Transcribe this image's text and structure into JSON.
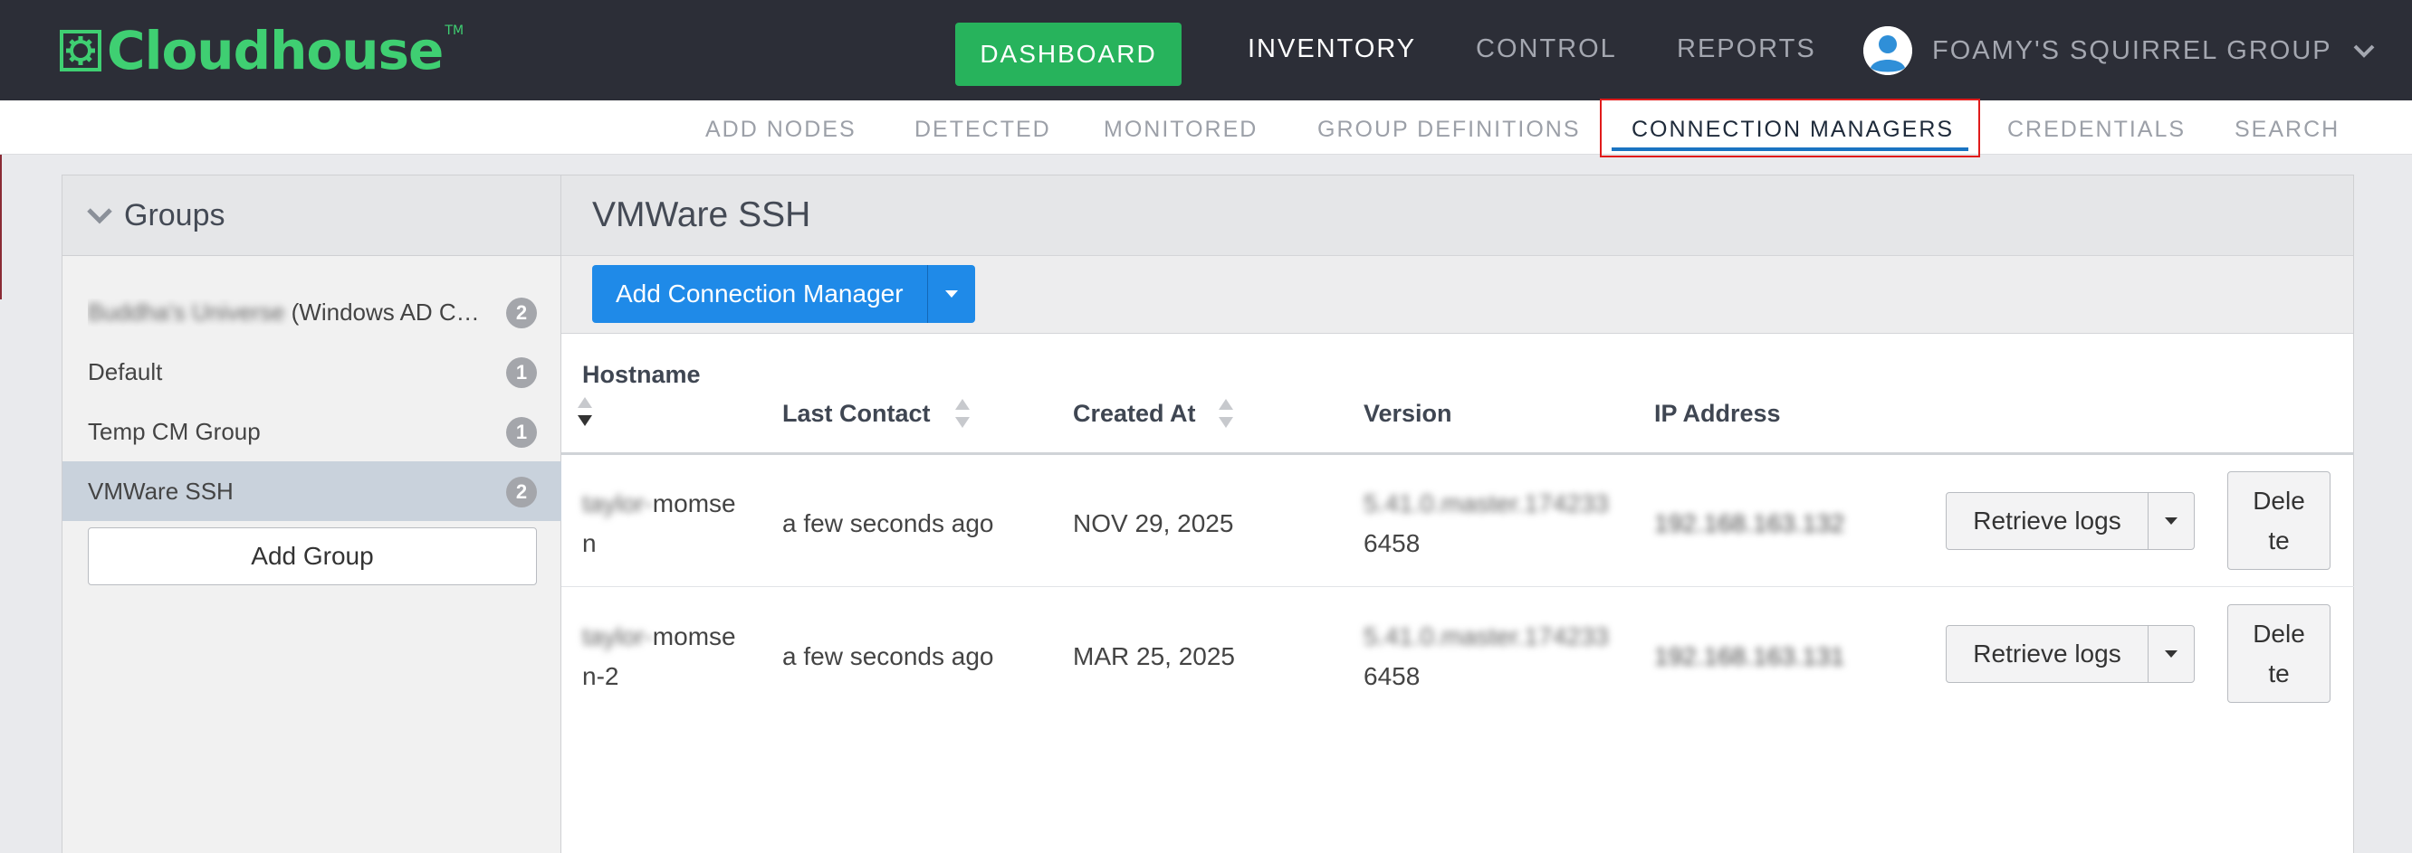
{
  "brand": {
    "name": "Cloudhouse",
    "tm": "TM",
    "color": "#3fcf72"
  },
  "topnav": {
    "dashboard": "DASHBOARD",
    "inventory": "INVENTORY",
    "control": "CONTROL",
    "reports": "REPORTS",
    "user": "FOAMY'S SQUIRREL GROUP"
  },
  "subnav": [
    "ADD NODES",
    "DETECTED",
    "MONITORED",
    "GROUP DEFINITIONS",
    "CONNECTION MANAGERS",
    "CREDENTIALS",
    "SEARCH"
  ],
  "groups": {
    "title": "Groups",
    "items": [
      {
        "blurred": "Buddha's Universe",
        "name": " (Windows AD C…",
        "count": "2"
      },
      {
        "name": "Default",
        "count": "1"
      },
      {
        "name": "Temp CM Group",
        "count": "1"
      },
      {
        "name": "VMWare SSH",
        "count": "2"
      }
    ],
    "add_label": "Add Group"
  },
  "main": {
    "title": "VMWare SSH",
    "add_button": "Add Connection Manager",
    "columns": [
      "Hostname",
      "Last Contact",
      "Created At",
      "Version",
      "IP Address"
    ],
    "rows": [
      {
        "host_blur": "taylor-",
        "host_a": "momse",
        "host_b": "n",
        "last_contact": "a few seconds ago",
        "created_at": "NOV 29, 2025",
        "version_blur": "5.41.0.master.174233",
        "version_b": "6458",
        "ip_blur": "192.168.163.132",
        "logs_label": "Retrieve logs",
        "delete_a": "Dele",
        "delete_b": "te"
      },
      {
        "host_blur": "taylor-",
        "host_a": "momse",
        "host_b": "n-2",
        "last_contact": "a few seconds ago",
        "created_at": "MAR 25, 2025",
        "version_blur": "5.41.0.master.174233",
        "version_b": "6458",
        "ip_blur": "192.168.163.131",
        "logs_label": "Retrieve logs",
        "delete_a": "Dele",
        "delete_b": "te"
      }
    ]
  }
}
